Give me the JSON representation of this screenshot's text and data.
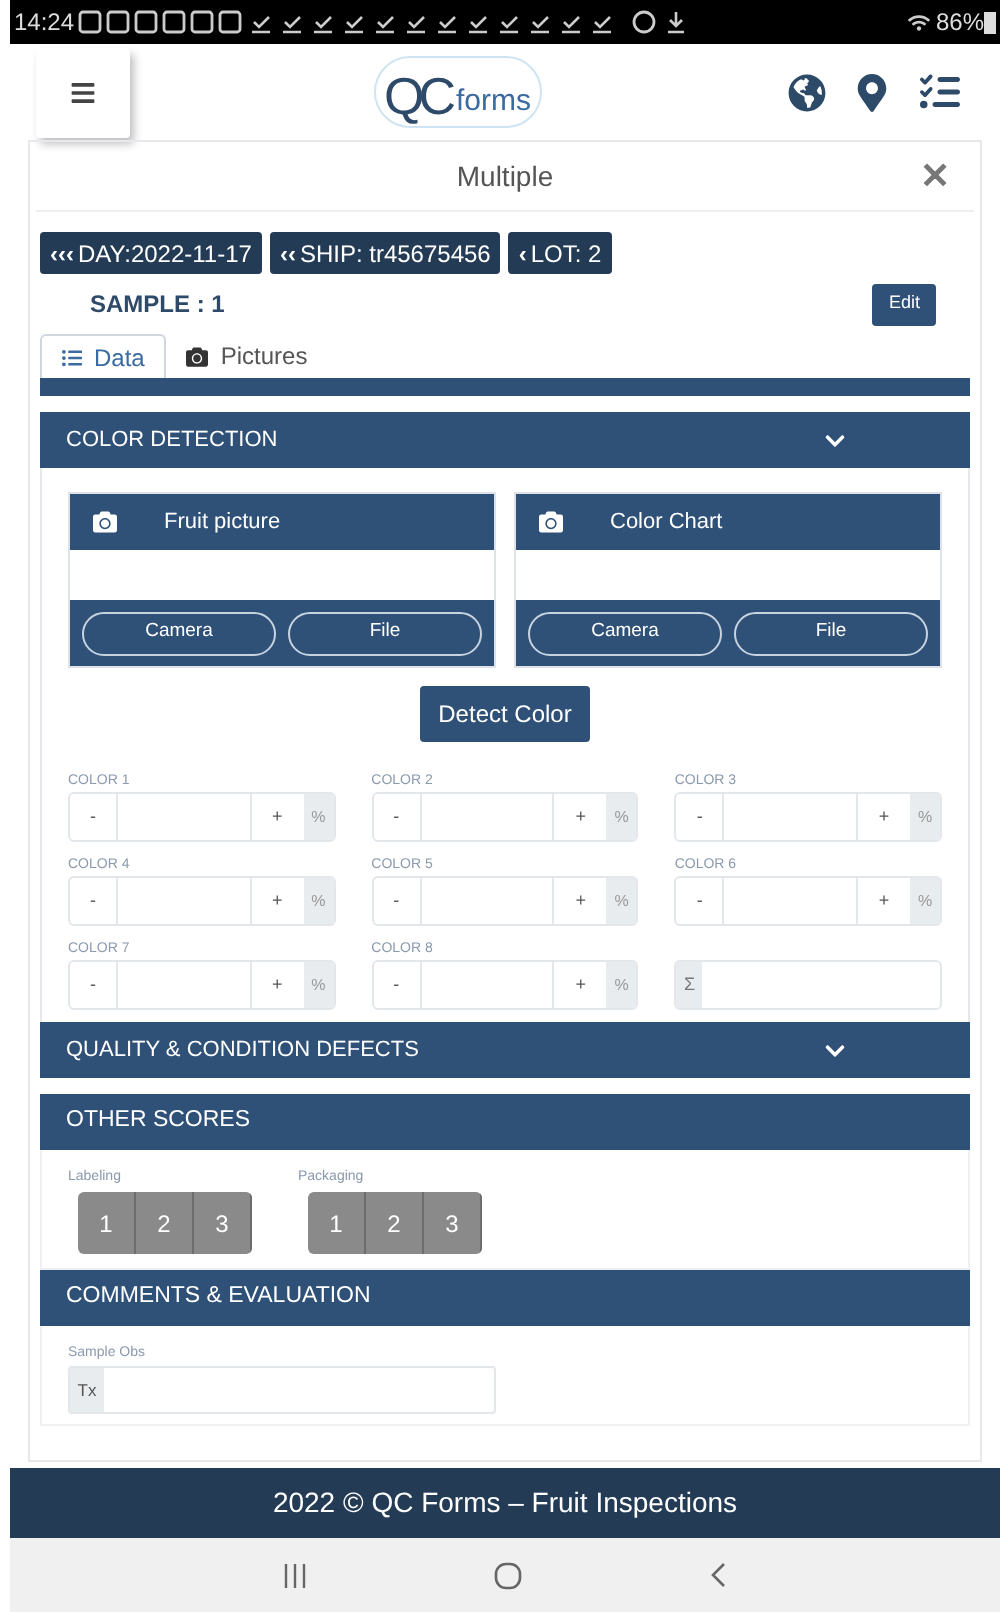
{
  "status_bar": {
    "time": "14:24",
    "battery": "86%"
  },
  "header": {
    "logo_mark": "QC",
    "logo_word": "forms"
  },
  "dialog": {
    "title": "Multiple",
    "close": "✕"
  },
  "breadcrumbs": [
    {
      "marker": "‹‹‹",
      "label": "DAY:2022-11-17"
    },
    {
      "marker": "‹‹",
      "label": "SHIP: tr45675456"
    },
    {
      "marker": "‹",
      "label": "LOT: 2"
    }
  ],
  "sample": {
    "label": "SAMPLE : 1",
    "edit_button": "Edit"
  },
  "tabs": [
    {
      "label": "Data",
      "kind": "list",
      "selected": true
    },
    {
      "label": "Pictures",
      "kind": "camera",
      "selected": false
    }
  ],
  "color_detection": {
    "title": "COLOR DETECTION",
    "photo_panels": [
      {
        "title": "Fruit picture",
        "buttons": [
          "Camera",
          "File"
        ]
      },
      {
        "title": "Color Chart",
        "buttons": [
          "Camera",
          "File"
        ]
      }
    ],
    "detect_button": "Detect Color",
    "colors": [
      {
        "label": "COLOR 1",
        "minus": "-",
        "plus": "+",
        "unit": "%"
      },
      {
        "label": "COLOR 2",
        "minus": "-",
        "plus": "+",
        "unit": "%"
      },
      {
        "label": "COLOR 3",
        "minus": "-",
        "plus": "+",
        "unit": "%"
      },
      {
        "label": "COLOR 4",
        "minus": "-",
        "plus": "+",
        "unit": "%"
      },
      {
        "label": "COLOR 5",
        "minus": "-",
        "plus": "+",
        "unit": "%"
      },
      {
        "label": "COLOR 6",
        "minus": "-",
        "plus": "+",
        "unit": "%"
      },
      {
        "label": "COLOR 7",
        "minus": "-",
        "plus": "+",
        "unit": "%"
      },
      {
        "label": "COLOR 8",
        "minus": "-",
        "plus": "+",
        "unit": "%"
      }
    ],
    "sum_symbol": "Σ"
  },
  "quality": {
    "title": "QUALITY & CONDITION DEFECTS"
  },
  "other_scores": {
    "title": "OTHER SCORES",
    "groups": [
      {
        "label": "Labeling",
        "options": [
          {
            "label": "1",
            "selected": false
          },
          {
            "label": "2",
            "selected": false
          },
          {
            "label": "3",
            "selected": false
          }
        ]
      },
      {
        "label": "Packaging",
        "options": [
          {
            "label": "1",
            "selected": false
          },
          {
            "label": "2",
            "selected": false
          },
          {
            "label": "3",
            "selected": false
          }
        ]
      }
    ]
  },
  "comments": {
    "title": "COMMENTS & EVALUATION",
    "field_label": "Sample Obs",
    "field_prefix": "Tx"
  },
  "footer": "2022 © QC Forms – Fruit Inspections"
}
